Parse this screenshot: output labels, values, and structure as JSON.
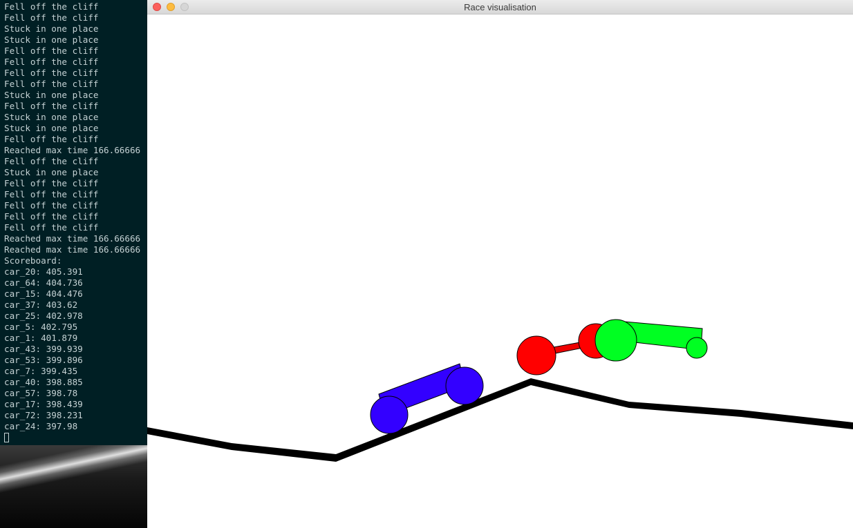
{
  "terminal": {
    "lines": [
      "Fell off the cliff",
      "Fell off the cliff",
      "Stuck in one place",
      "Stuck in one place",
      "Fell off the cliff",
      "Fell off the cliff",
      "Fell off the cliff",
      "Fell off the cliff",
      "Stuck in one place",
      "Fell off the cliff",
      "Stuck in one place",
      "Stuck in one place",
      "Fell off the cliff",
      "Reached max time 166.66666",
      "Fell off the cliff",
      "Stuck in one place",
      "Fell off the cliff",
      "Fell off the cliff",
      "Fell off the cliff",
      "Fell off the cliff",
      "Fell off the cliff",
      "Reached max time 166.66666",
      "Reached max time 166.66666",
      "Scoreboard:",
      "car_20: 405.391",
      "car_64: 404.736",
      "car_15: 404.476",
      "car_37: 403.62",
      "car_25: 402.978",
      "car_5: 402.795",
      "car_1: 401.879",
      "car_43: 399.939",
      "car_53: 399.896",
      "car_7: 399.435",
      "car_40: 398.885",
      "car_57: 398.78",
      "car_17: 398.439",
      "car_72: 398.231",
      "car_24: 397.98"
    ]
  },
  "window": {
    "title": "Race visualisation"
  },
  "scene": {
    "track_color": "#000000",
    "cars": [
      {
        "name": "blue-car",
        "color": "#3300ff"
      },
      {
        "name": "red-car",
        "color": "#ff0000"
      },
      {
        "name": "green-car",
        "color": "#00ff22"
      }
    ]
  }
}
